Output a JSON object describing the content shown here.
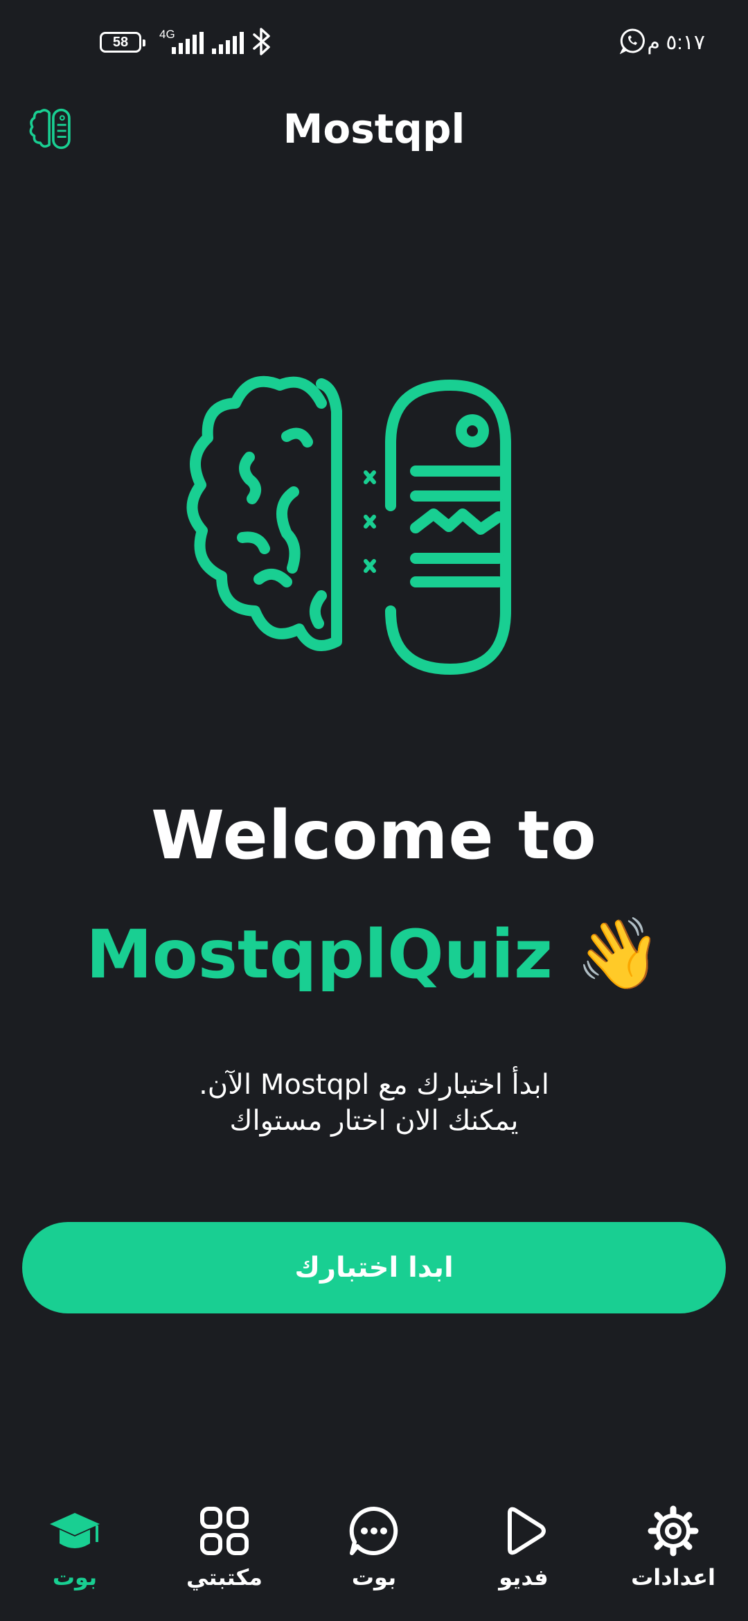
{
  "status_bar": {
    "battery": "58",
    "network": "4G",
    "time": "٥:١٧ م"
  },
  "header": {
    "title": "Mostqpl"
  },
  "welcome": {
    "line1": "Welcome to",
    "line2": "MostqplQuiz",
    "emoji": "👋"
  },
  "subtitle": {
    "line1": "ابدأ اختبارك مع Mostqpl الآن.",
    "line2": "يمكنك الان اختار مستواك"
  },
  "start_button": {
    "label": "ابدا اختبارك"
  },
  "nav": {
    "items": [
      {
        "label": "بوت",
        "icon": "graduation-cap-icon",
        "active": true
      },
      {
        "label": "مكتبتي",
        "icon": "grid-icon",
        "active": false
      },
      {
        "label": "بوت",
        "icon": "chat-dots-icon",
        "active": false
      },
      {
        "label": "فديو",
        "icon": "play-icon",
        "active": false
      },
      {
        "label": "اعدادات",
        "icon": "gear-icon",
        "active": false
      }
    ]
  },
  "colors": {
    "background": "#1b1d21",
    "accent": "#19cf92",
    "text": "#ffffff"
  }
}
